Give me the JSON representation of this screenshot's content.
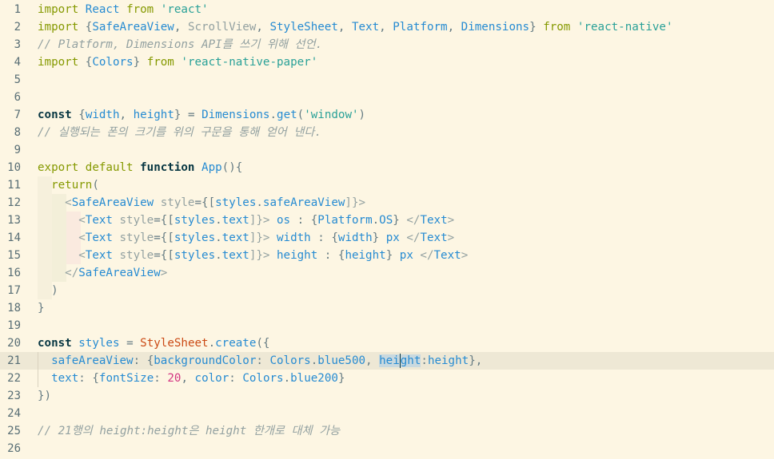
{
  "editor": {
    "lines": [
      {
        "n": "1",
        "text": "import React from 'react'"
      },
      {
        "n": "2",
        "text": "import {SafeAreaView, ScrollView, StyleSheet, Text, Platform, Dimensions} from 'react-native'"
      },
      {
        "n": "3",
        "text": "// Platform, Dimensions API를 쓰기 위해 선언."
      },
      {
        "n": "4",
        "text": "import {Colors} from 'react-native-paper'"
      },
      {
        "n": "5",
        "text": ""
      },
      {
        "n": "6",
        "text": ""
      },
      {
        "n": "7",
        "text": "const {width, height} = Dimensions.get('window')"
      },
      {
        "n": "8",
        "text": "// 실행되는 폰의 크기를 위의 구문을 통해 얻어 낸다."
      },
      {
        "n": "9",
        "text": ""
      },
      {
        "n": "10",
        "text": "export default function App(){"
      },
      {
        "n": "11",
        "text": "  return("
      },
      {
        "n": "12",
        "text": "    <SafeAreaView style={[styles.safeAreaView]}>"
      },
      {
        "n": "13",
        "text": "      <Text style={[styles.text]}> os : {Platform.OS} </Text>"
      },
      {
        "n": "14",
        "text": "      <Text style={[styles.text]}> width : {width} px </Text>"
      },
      {
        "n": "15",
        "text": "      <Text style={[styles.text]}> height : {height} px </Text>"
      },
      {
        "n": "16",
        "text": "    </SafeAreaView>"
      },
      {
        "n": "17",
        "text": "  )"
      },
      {
        "n": "18",
        "text": "}"
      },
      {
        "n": "19",
        "text": ""
      },
      {
        "n": "20",
        "text": "const styles = StyleSheet.create({"
      },
      {
        "n": "21",
        "text": "  safeAreaView: {backgroundColor: Colors.blue500, height:height},"
      },
      {
        "n": "22",
        "text": "  text: {fontSize: 20, color: Colors.blue200}"
      },
      {
        "n": "23",
        "text": "})"
      },
      {
        "n": "24",
        "text": ""
      },
      {
        "n": "25",
        "text": "// 21행의 height:height은 height 한개로 대체 가능"
      },
      {
        "n": "26",
        "text": ""
      }
    ]
  },
  "colors": {
    "background": "#fdf6e3",
    "current_line": "#eee8d5",
    "keyword": "#859900",
    "string": "#2aa198",
    "comment": "#93a1a1",
    "identifier": "#268bd2",
    "number": "#d33682"
  }
}
